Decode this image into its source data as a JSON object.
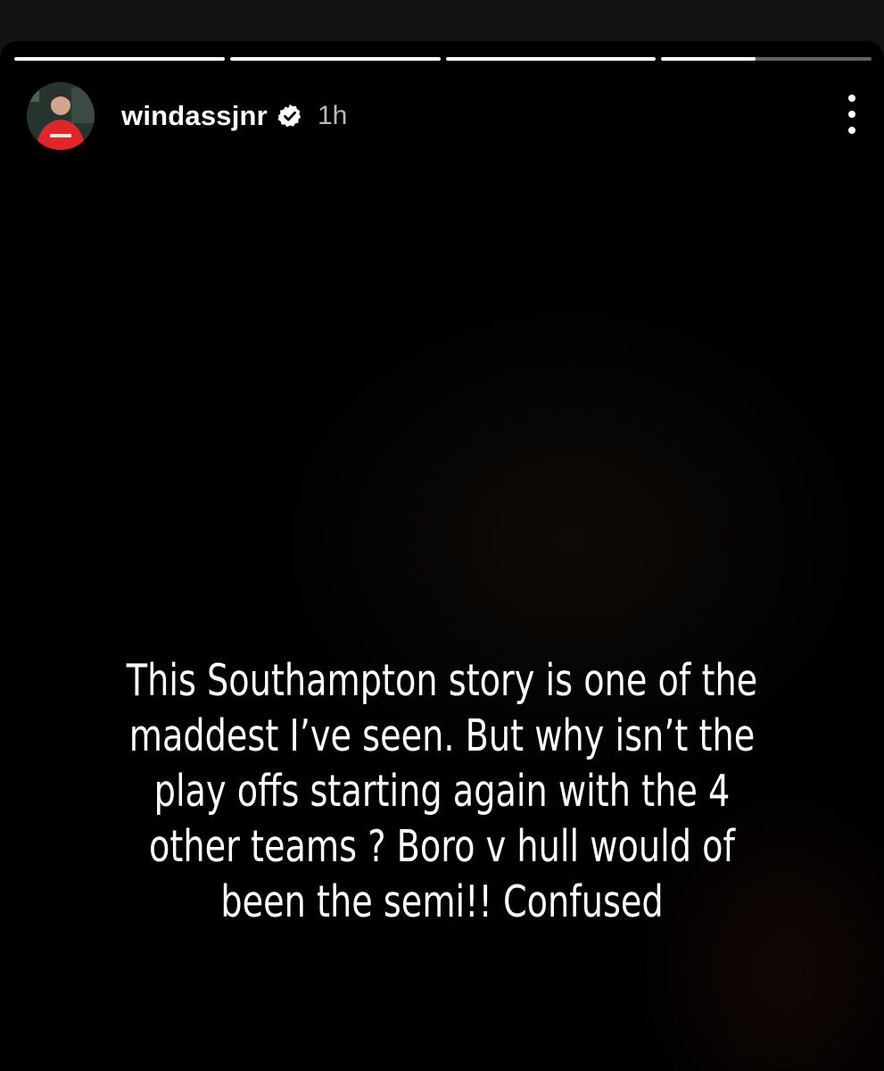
{
  "story": {
    "progress": [
      1.0,
      1.0,
      1.0,
      0.45
    ],
    "username": "windassjnr",
    "time": "1h",
    "verified": true,
    "caption_lines": [
      "This Southampton story is one of the",
      "maddest I’ve seen. But why isn’t the",
      "play offs starting again with the 4",
      "other teams ? Boro v hull would of",
      "been the semi!! Confused"
    ]
  },
  "icons": {
    "verified": "verified-badge-icon",
    "more": "more-options-icon"
  },
  "colors": {
    "background": "#000000",
    "text": "#ffffff",
    "progress_track": "rgba(255,255,255,0.38)",
    "progress_fill": "#ffffff"
  }
}
